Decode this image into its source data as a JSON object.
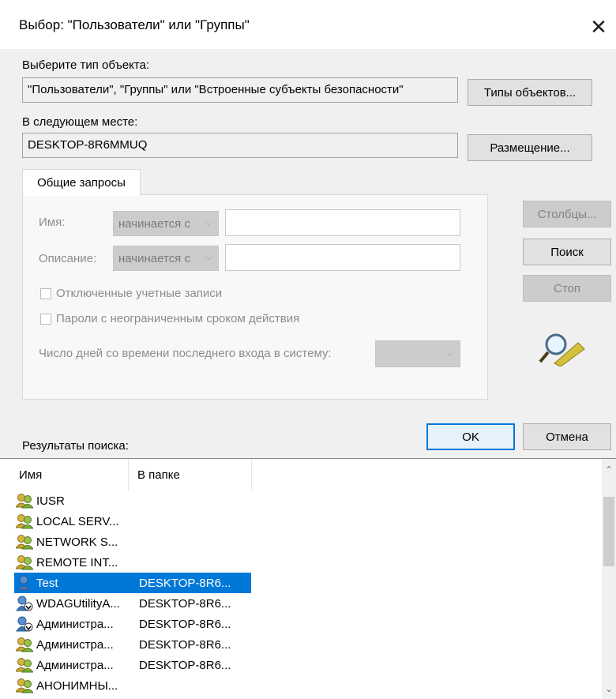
{
  "window": {
    "title": "Выбор: \"Пользователи\" или \"Группы\"",
    "close_glyph": "✕"
  },
  "object_type": {
    "label": "Выберите тип объекта:",
    "value": "\"Пользователи\", \"Группы\" или \"Встроенные субъекты безопасности\"",
    "button": "Типы объектов..."
  },
  "location": {
    "label": "В следующем месте:",
    "value": "DESKTOP-8R6MMUQ",
    "button": "Размещение..."
  },
  "tab": {
    "label": "Общие запросы"
  },
  "query": {
    "name_label": "Имя:",
    "name_combo": "начинается с",
    "desc_label": "Описание:",
    "desc_combo": "начинается с",
    "disabled_accounts": "Отключенные учетные записи",
    "no_expire_passwords": "Пароли с неограниченным сроком действия",
    "days_label": "Число дней со времени последнего входа в систему:"
  },
  "side_buttons": {
    "columns": "Столбцы...",
    "search": "Поиск",
    "stop": "Стоп"
  },
  "footer": {
    "results_label": "Результаты поиска:",
    "ok": "OK",
    "cancel": "Отмена"
  },
  "results": {
    "columns": [
      "Имя",
      "В папке"
    ],
    "rows": [
      {
        "name": "IUSR",
        "folder": "",
        "icon": "group-icon"
      },
      {
        "name": "LOCAL SERV...",
        "folder": "",
        "icon": "group-icon"
      },
      {
        "name": "NETWORK S...",
        "folder": "",
        "icon": "group-icon"
      },
      {
        "name": "REMOTE INT...",
        "folder": "",
        "icon": "group-icon"
      },
      {
        "name": "Test",
        "folder": "DESKTOP-8R6...",
        "icon": "user-icon",
        "selected": true
      },
      {
        "name": "WDAGUtilityA...",
        "folder": "DESKTOP-8R6...",
        "icon": "disabled-user-icon"
      },
      {
        "name": "Администра...",
        "folder": "DESKTOP-8R6...",
        "icon": "disabled-user-icon"
      },
      {
        "name": "Администра...",
        "folder": "DESKTOP-8R6...",
        "icon": "group-icon"
      },
      {
        "name": "Администра...",
        "folder": "DESKTOP-8R6...",
        "icon": "group-icon"
      },
      {
        "name": "АНОНИМНЫ...",
        "folder": "",
        "icon": "group-icon"
      }
    ]
  },
  "colors": {
    "selection": "#0078d7",
    "dialog_bg": "#f0f0f0",
    "accent_border": "#0078d7"
  }
}
